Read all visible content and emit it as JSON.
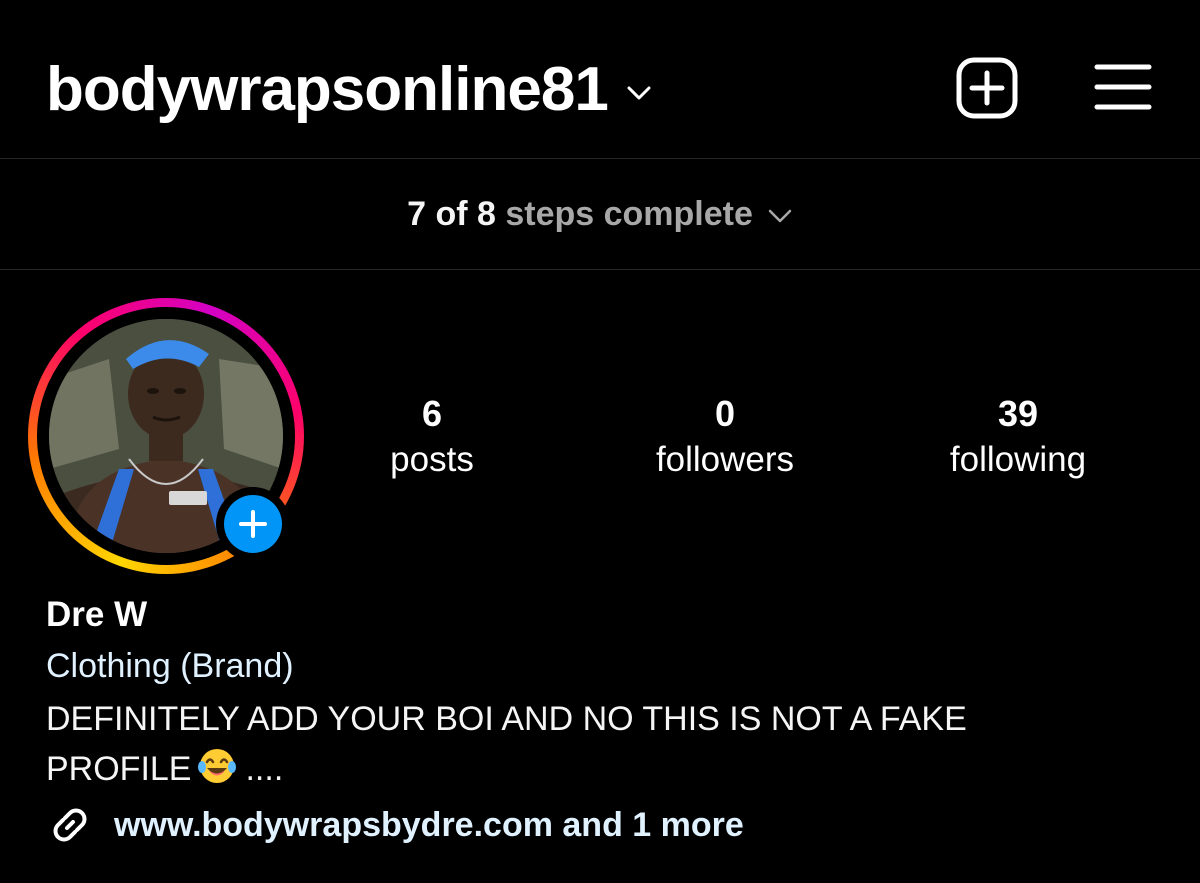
{
  "header": {
    "username": "bodywrapsonline81",
    "create_icon": "plus-square-icon",
    "menu_icon": "hamburger-menu-icon"
  },
  "steps": {
    "count": "7 of 8",
    "label": "steps complete"
  },
  "profile": {
    "stats": [
      {
        "value": "6",
        "label": "posts"
      },
      {
        "value": "0",
        "label": "followers"
      },
      {
        "value": "39",
        "label": "following"
      }
    ],
    "display_name": "Dre W",
    "category": "Clothing (Brand)",
    "bio_line1": "DEFINITELY ADD YOUR BOI AND NO THIS IS NOT A FAKE",
    "bio_line2_start": "PROFILE",
    "bio_line2_end": "....",
    "link": "www.bodywrapsbydre.com and 1 more"
  },
  "colors": {
    "background": "#000000",
    "accent_blue": "#0095f6",
    "link_color": "#e0f1ff",
    "muted_text": "#a8a8a8",
    "divider": "#262626"
  }
}
